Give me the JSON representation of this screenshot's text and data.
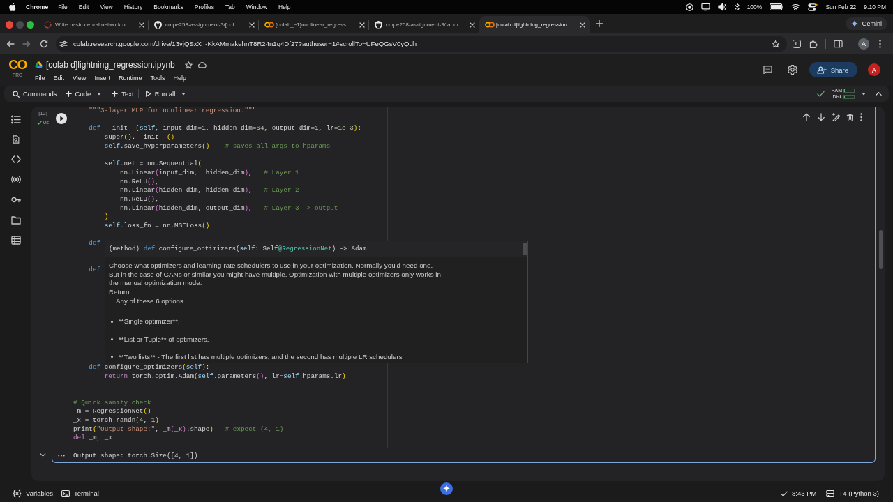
{
  "menu_bar": {
    "app": "Chrome",
    "items": [
      "File",
      "Edit",
      "View",
      "History",
      "Bookmarks",
      "Profiles",
      "Tab",
      "Window",
      "Help"
    ],
    "battery": "100%",
    "date": "Sun Feb 22",
    "time": "9:10 PM"
  },
  "tabs": [
    {
      "title": "Write basic neural network u",
      "kind": "ring",
      "selected": false
    },
    {
      "title": "cmpe258-assignment-3/[col",
      "kind": "github",
      "selected": false
    },
    {
      "title": "[colab_e1]nonlinear_regress",
      "kind": "colab",
      "selected": false
    },
    {
      "title": "cmpe258-assignment-3/ at m",
      "kind": "github",
      "selected": false
    },
    {
      "title": "[colab d]lightning_regression",
      "kind": "colab",
      "selected": true
    }
  ],
  "assistant_button": "Gemini",
  "address_bar": {
    "url": "colab.research.google.com/drive/13vjQSxX_-KkAMmakehnT8R24n1q4Df27?authuser=1#scrollTo=UFeQGsV0yQdh",
    "forward_disabled": true,
    "extension": "L",
    "profile": "A"
  },
  "notebook": {
    "logo": "CO",
    "plan": "PRO",
    "title": "[colab d]lightning_regression.ipynb",
    "menu": [
      "File",
      "Edit",
      "View",
      "Insert",
      "Runtime",
      "Tools",
      "Help"
    ],
    "share": "Share",
    "avatar": "A"
  },
  "toolbar": {
    "items": [
      {
        "label": "Commands",
        "kind": "search",
        "caret": false
      },
      {
        "label": "Code",
        "kind": "add",
        "caret": true
      },
      {
        "label": "Text",
        "kind": "add",
        "caret": false
      },
      {
        "label": "Run all",
        "kind": "run",
        "caret": true
      }
    ],
    "resources": [
      {
        "label": "RAM",
        "level": 0.05
      },
      {
        "label": "Disk",
        "level": 0.05
      }
    ]
  },
  "cell": {
    "execution_count": "[12]",
    "duration": "0s",
    "code": [
      {
        "kind": "code",
        "tokens": [
          {
            "text": "    \"\"\"3-layer MLP for nonlinear regression.\"\"\"",
            "kind": "string"
          }
        ]
      },
      {
        "kind": "blank"
      },
      {
        "kind": "code",
        "tokens": [
          {
            "text": "    def",
            "kind": "kw"
          },
          {
            "text": " __init__",
            "kind": "text"
          },
          {
            "text": "(",
            "kind": "p1"
          },
          {
            "text": "self",
            "kind": "var"
          },
          {
            "text": ", input_dim=",
            "kind": "text"
          },
          {
            "text": "1",
            "kind": "num"
          },
          {
            "text": ", hidden_dim=",
            "kind": "text"
          },
          {
            "text": "64",
            "kind": "num"
          },
          {
            "text": ", output_dim=",
            "kind": "text"
          },
          {
            "text": "1",
            "kind": "num"
          },
          {
            "text": ", lr=",
            "kind": "text"
          },
          {
            "text": "1e-3",
            "kind": "num"
          },
          {
            "text": ")",
            "kind": "p1"
          },
          {
            "text": ":",
            "kind": "text"
          }
        ]
      },
      {
        "kind": "code",
        "tokens": [
          {
            "text": "        super",
            "kind": "text"
          },
          {
            "text": "()",
            "kind": "p1"
          },
          {
            "text": ".__init__",
            "kind": "text"
          },
          {
            "text": "()",
            "kind": "p1"
          }
        ]
      },
      {
        "kind": "code",
        "tokens": [
          {
            "text": "        self",
            "kind": "var"
          },
          {
            "text": ".save_hyperparameters",
            "kind": "text"
          },
          {
            "text": "()",
            "kind": "p1"
          },
          {
            "text": "    # saves all args to hparams",
            "kind": "comment"
          }
        ]
      },
      {
        "kind": "blank"
      },
      {
        "kind": "code",
        "tokens": [
          {
            "text": "        self",
            "kind": "var"
          },
          {
            "text": ".net = nn.Sequential",
            "kind": "text"
          },
          {
            "text": "(",
            "kind": "p1"
          }
        ]
      },
      {
        "kind": "code",
        "tokens": [
          {
            "text": "            nn.Linear",
            "kind": "text"
          },
          {
            "text": "(",
            "kind": "p2"
          },
          {
            "text": "input_dim,  hidden_dim",
            "kind": "text"
          },
          {
            "text": ")",
            "kind": "p2"
          },
          {
            "text": ",   ",
            "kind": "text"
          },
          {
            "text": "# Layer 1",
            "kind": "comment"
          }
        ]
      },
      {
        "kind": "code",
        "tokens": [
          {
            "text": "            nn.ReLU",
            "kind": "text"
          },
          {
            "text": "()",
            "kind": "p2"
          },
          {
            "text": ",",
            "kind": "text"
          }
        ]
      },
      {
        "kind": "code",
        "tokens": [
          {
            "text": "            nn.Linear",
            "kind": "text"
          },
          {
            "text": "(",
            "kind": "p2"
          },
          {
            "text": "hidden_dim, hidden_dim",
            "kind": "text"
          },
          {
            "text": ")",
            "kind": "p2"
          },
          {
            "text": ",   ",
            "kind": "text"
          },
          {
            "text": "# Layer 2",
            "kind": "comment"
          }
        ]
      },
      {
        "kind": "code",
        "tokens": [
          {
            "text": "            nn.ReLU",
            "kind": "text"
          },
          {
            "text": "()",
            "kind": "p2"
          },
          {
            "text": ",",
            "kind": "text"
          }
        ]
      },
      {
        "kind": "code",
        "tokens": [
          {
            "text": "            nn.Linear",
            "kind": "text"
          },
          {
            "text": "(",
            "kind": "p2"
          },
          {
            "text": "hidden_dim, output_dim",
            "kind": "text"
          },
          {
            "text": ")",
            "kind": "p2"
          },
          {
            "text": ",   ",
            "kind": "text"
          },
          {
            "text": "# Layer 3 -> output",
            "kind": "comment"
          }
        ]
      },
      {
        "kind": "code",
        "tokens": [
          {
            "text": "        )",
            "kind": "p1"
          }
        ]
      },
      {
        "kind": "code",
        "tokens": [
          {
            "text": "        self",
            "kind": "var"
          },
          {
            "text": ".loss_fn = nn.MSELoss",
            "kind": "text"
          },
          {
            "text": "()",
            "kind": "p1"
          }
        ]
      },
      {
        "kind": "blank"
      },
      {
        "kind": "code",
        "tokens": [
          {
            "text": "    def",
            "kind": "kw"
          }
        ]
      },
      {
        "kind": "blank"
      },
      {
        "kind": "blank"
      },
      {
        "kind": "code",
        "tokens": [
          {
            "text": "    def",
            "kind": "kw"
          }
        ]
      },
      {
        "kind": "blank"
      },
      {
        "kind": "blank"
      },
      {
        "kind": "blank"
      },
      {
        "kind": "blank"
      },
      {
        "kind": "blank"
      },
      {
        "kind": "blank"
      },
      {
        "kind": "blank"
      },
      {
        "kind": "blank"
      },
      {
        "kind": "blank"
      },
      {
        "kind": "blank"
      },
      {
        "kind": "code",
        "tokens": [
          {
            "text": "    def",
            "kind": "kw"
          },
          {
            "text": " configure_optimizers",
            "kind": "text"
          },
          {
            "text": "(",
            "kind": "p1"
          },
          {
            "text": "self",
            "kind": "var"
          },
          {
            "text": ")",
            "kind": "p1"
          },
          {
            "text": ":",
            "kind": "text"
          }
        ]
      },
      {
        "kind": "code",
        "tokens": [
          {
            "text": "        return",
            "kind": "ctrl"
          },
          {
            "text": " torch.optim.Adam",
            "kind": "text"
          },
          {
            "text": "(",
            "kind": "p1"
          },
          {
            "text": "self",
            "kind": "var"
          },
          {
            "text": ".parameters",
            "kind": "text"
          },
          {
            "text": "()",
            "kind": "p2"
          },
          {
            "text": ", lr=",
            "kind": "text"
          },
          {
            "text": "self",
            "kind": "var"
          },
          {
            "text": ".hparams.lr",
            "kind": "text"
          },
          {
            "text": ")",
            "kind": "p1"
          }
        ]
      },
      {
        "kind": "blank"
      },
      {
        "kind": "blank"
      },
      {
        "kind": "code",
        "tokens": [
          {
            "text": "# Quick sanity check",
            "kind": "comment"
          }
        ]
      },
      {
        "kind": "code",
        "tokens": [
          {
            "text": "_m = RegressionNet",
            "kind": "text"
          },
          {
            "text": "()",
            "kind": "p1"
          }
        ]
      },
      {
        "kind": "code",
        "tokens": [
          {
            "text": "_x = torch.randn",
            "kind": "text"
          },
          {
            "text": "(",
            "kind": "p1"
          },
          {
            "text": "4",
            "kind": "num"
          },
          {
            "text": ", ",
            "kind": "text"
          },
          {
            "text": "1",
            "kind": "num"
          },
          {
            "text": ")",
            "kind": "p1"
          }
        ]
      },
      {
        "kind": "code",
        "tokens": [
          {
            "text": "print",
            "kind": "text"
          },
          {
            "text": "(",
            "kind": "p1"
          },
          {
            "text": "\"Output shape:\"",
            "kind": "string"
          },
          {
            "text": ", _m",
            "kind": "text"
          },
          {
            "text": "(",
            "kind": "p2"
          },
          {
            "text": "_x",
            "kind": "text"
          },
          {
            "text": ")",
            "kind": "p2"
          },
          {
            "text": ".shape",
            "kind": "text"
          },
          {
            "text": ")",
            "kind": "p1"
          },
          {
            "text": "   # expect (4, 1)",
            "kind": "comment"
          }
        ]
      },
      {
        "kind": "code",
        "tokens": [
          {
            "text": "del",
            "kind": "ctrl"
          },
          {
            "text": " _m, _x",
            "kind": "text"
          }
        ]
      }
    ],
    "tooltip": {
      "signature": [
        {
          "text": "(method) ",
          "kind": "text"
        },
        {
          "text": "def",
          "kind": "kw"
        },
        {
          "text": " configure_optimizers(",
          "kind": "text"
        },
        {
          "text": "self",
          "kind": "var"
        },
        {
          "text": ": Self",
          "kind": "text"
        },
        {
          "text": "@RegressionNet",
          "kind": "class"
        },
        {
          "text": ") -> Adam",
          "kind": "text"
        }
      ],
      "description": "Choose what optimizers and learning-rate schedulers to use in your optimization. Normally you'd need one. But in the case of GANs or similar you might have multiple. Optimization with multiple optimizers only works in the manual optimization mode.",
      "return_label": "Return:",
      "return_text": "Any of these 6 options.",
      "bullets": [
        "**Single optimizer**.",
        "**List or Tuple** of optimizers.",
        "**Two lists** - The first list has multiple optimizers, and the second has multiple LR schedulers"
      ]
    },
    "output": "Output shape: torch.Size([4, 1])"
  },
  "status_bar": {
    "variables": "Variables",
    "terminal": "Terminal",
    "saved_at": "8:43 PM",
    "runtime": "T4 (Python 3)"
  }
}
